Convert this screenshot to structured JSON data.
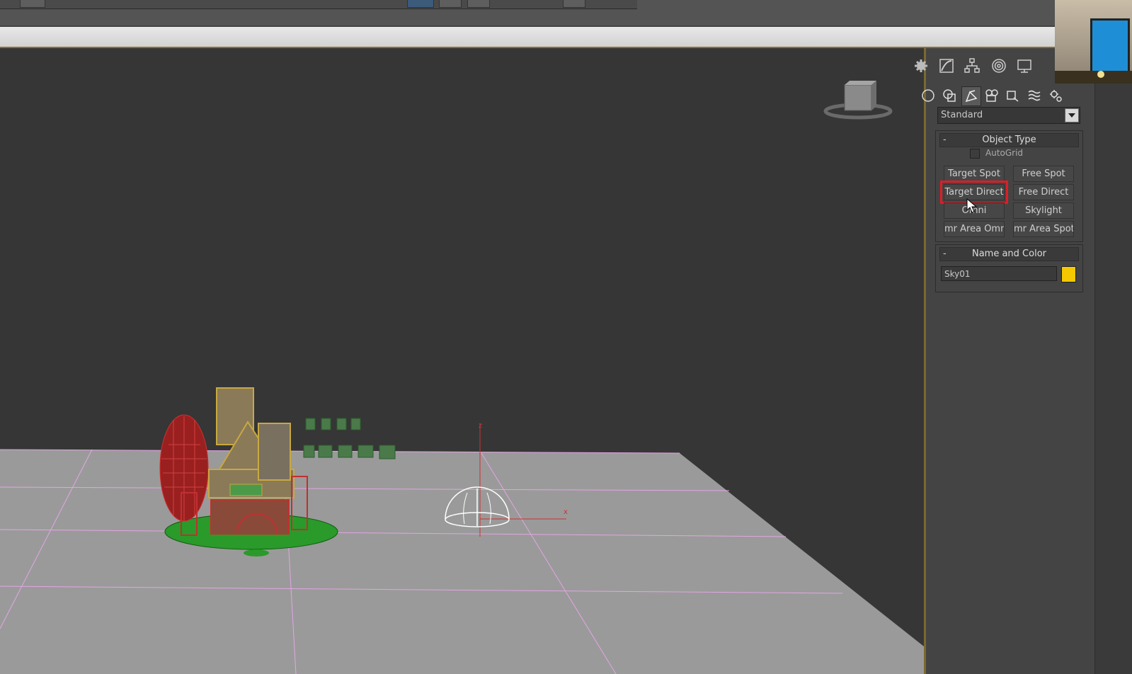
{
  "panel": {
    "dropdown_value": "Standard",
    "object_type": {
      "title": "Object Type",
      "collapse_symbol": "-",
      "autogrid_label": "AutoGrid",
      "buttons": [
        "Target Spot",
        "Free Spot",
        "Target Direct",
        "Free Direct",
        "Omni",
        "Skylight",
        "mr Area Omni",
        "mr Area Spot"
      ]
    },
    "name_and_color": {
      "title": "Name and Color",
      "collapse_symbol": "-",
      "name_value": "Sky01",
      "color": "#f5c800"
    }
  },
  "viewport": {
    "gizmo_z": "z",
    "gizmo_x": "x"
  },
  "icons": {
    "tabs": [
      "create-icon",
      "modify-icon",
      "hierarchy-icon",
      "motion-icon",
      "display-icon"
    ],
    "categories": [
      "geometry-icon",
      "shapes-icon",
      "lights-icon",
      "cameras-icon",
      "helpers-icon",
      "spacewarps-icon",
      "systems-icon"
    ]
  },
  "colors": {
    "highlight": "#e01c24",
    "grid": "#e3a6e3",
    "ground": "#9a9a9a",
    "viewport_bg": "#363636"
  }
}
